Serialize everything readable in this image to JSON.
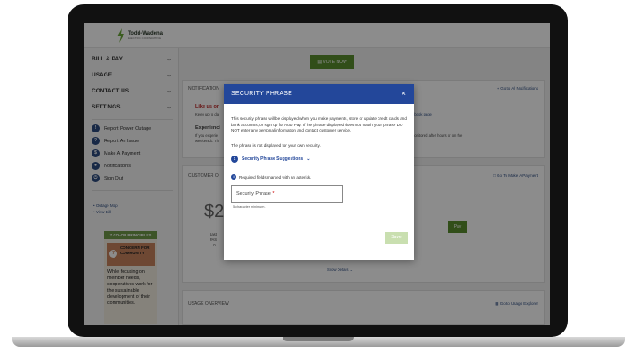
{
  "brand": {
    "name": "Todd-Wadena",
    "tagline": "ELECTRIC COOPERATIVE",
    "accent": "#5a8f2e",
    "modal_header": "#23479a"
  },
  "sidebar": {
    "menus": [
      {
        "label": "BILL & PAY"
      },
      {
        "label": "USAGE"
      },
      {
        "label": "CONTACT US"
      },
      {
        "label": "SETTINGS"
      }
    ],
    "quick_actions": [
      {
        "label": "Report Power Outage",
        "icon": "power-outage-icon"
      },
      {
        "label": "Report An Issue",
        "icon": "issue-icon"
      },
      {
        "label": "Make A Payment",
        "icon": "payment-icon"
      },
      {
        "label": "Notifications",
        "icon": "bell-icon"
      },
      {
        "label": "Sign Out",
        "icon": "sign-out-icon"
      }
    ],
    "links": [
      "Outage Map",
      "View Bill"
    ],
    "promo": {
      "header": "7 CO-OP PRINCIPLES",
      "number": "7",
      "title": "CONCERN FOR COMMUNITY",
      "body": "While focusing on member needs, cooperatives work for the sustainable development of their communities."
    }
  },
  "main": {
    "vote_label": "VOTE NOW",
    "notifications": {
      "title": "NOTIFICATION",
      "link": "Go to All Notifications",
      "alert_title": "Like us on",
      "alert_text": "Keep up to da",
      "fb_link": "ebook page",
      "exp_title": "Experienci",
      "exp_text1": "If you experie",
      "exp_text2": "weekends. Th",
      "exp_right": "nonitored after hours or on the"
    },
    "customer": {
      "title": "CUSTOMER O",
      "link": "Go To Make A Payment",
      "amount": "$2",
      "last1": "Last",
      "last2": "PAS",
      "last3": "A",
      "pay_label": "Pay",
      "show_details": "Show Details"
    },
    "usage": {
      "title": "USAGE OVERVIEW",
      "link": "Go to Usage Explorer"
    }
  },
  "modal": {
    "title": "SECURITY PHRASE",
    "close": "×",
    "description": "This security phrase will be displayed when you make payments, store or update credit cards and bank accounts, or sign up for Auto Pay. If the phrase displayed does not match your phrase DO NOT enter any personal information and contact customer service.",
    "note": "The phrase is not displayed for your own security.",
    "suggestions_label": "Security Phrase Suggestions",
    "suggestions_num": "1",
    "required_note": "Required fields marked with an asterisk.",
    "field_label": "Security Phrase",
    "field_required": "*",
    "field_help": "5 character minimum.",
    "save_label": "Save"
  }
}
